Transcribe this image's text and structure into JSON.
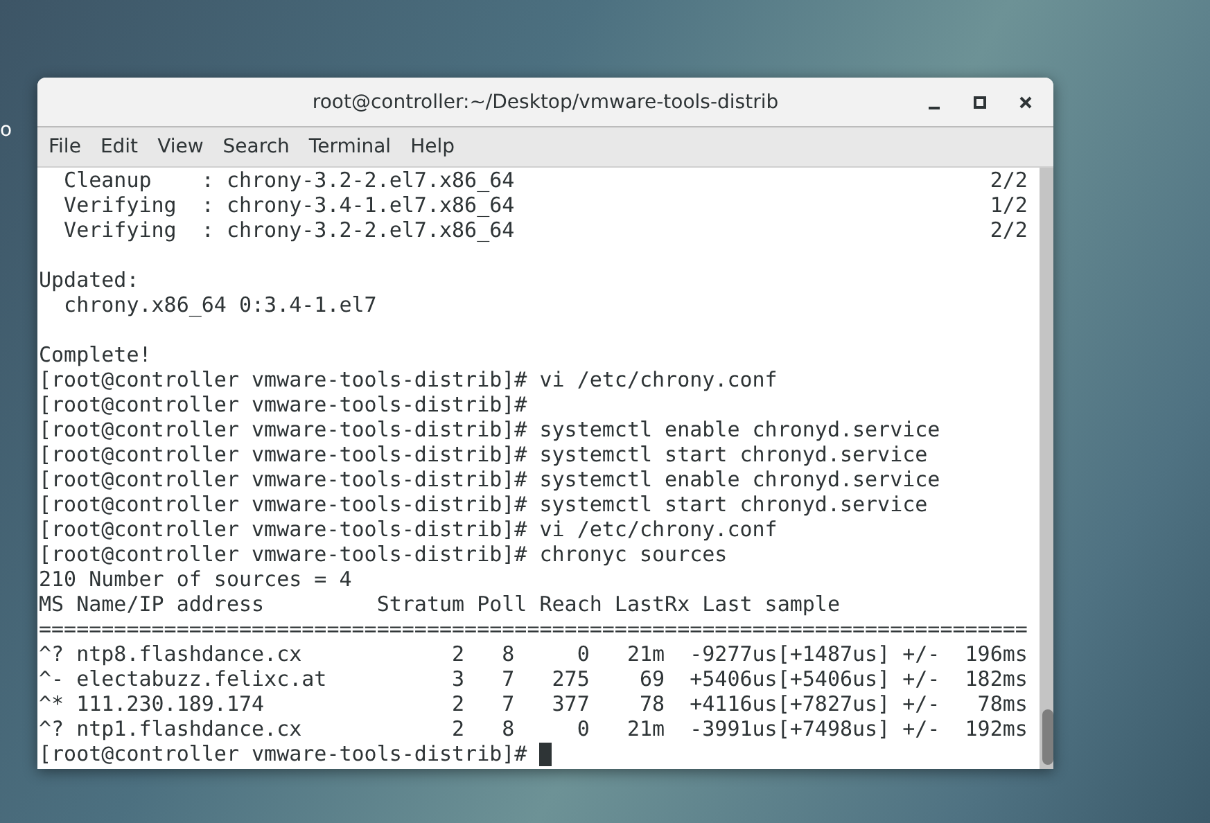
{
  "desktop": {
    "label": "o"
  },
  "window": {
    "title": "root@controller:~/Desktop/vmware-tools-distrib"
  },
  "menu": [
    "File",
    "Edit",
    "View",
    "Search",
    "Terminal",
    "Help"
  ],
  "terminal": {
    "lines": [
      {
        "kind": "text",
        "text": "  Cleanup    : chrony-3.2-2.el7.x86_64",
        "right": "2/2"
      },
      {
        "kind": "text",
        "text": "  Verifying  : chrony-3.4-1.el7.x86_64",
        "right": "1/2"
      },
      {
        "kind": "text",
        "text": "  Verifying  : chrony-3.2-2.el7.x86_64",
        "right": "2/2"
      },
      {
        "kind": "blank"
      },
      {
        "kind": "text",
        "text": "Updated:"
      },
      {
        "kind": "text",
        "text": "  chrony.x86_64 0:3.4-1.el7"
      },
      {
        "kind": "blank"
      },
      {
        "kind": "text",
        "text": "Complete!"
      },
      {
        "kind": "text",
        "text": "[root@controller vmware-tools-distrib]# vi /etc/chrony.conf"
      },
      {
        "kind": "text",
        "text": "[root@controller vmware-tools-distrib]#"
      },
      {
        "kind": "text",
        "text": "[root@controller vmware-tools-distrib]# systemctl enable chronyd.service"
      },
      {
        "kind": "text",
        "text": "[root@controller vmware-tools-distrib]# systemctl start chronyd.service"
      },
      {
        "kind": "text",
        "text": "[root@controller vmware-tools-distrib]# systemctl enable chronyd.service"
      },
      {
        "kind": "text",
        "text": "[root@controller vmware-tools-distrib]# systemctl start chronyd.service"
      },
      {
        "kind": "text",
        "text": "[root@controller vmware-tools-distrib]# vi /etc/chrony.conf"
      },
      {
        "kind": "text",
        "text": "[root@controller vmware-tools-distrib]# chronyc sources"
      },
      {
        "kind": "text",
        "text": "210 Number of sources = 4"
      },
      {
        "kind": "text",
        "text": "MS Name/IP address         Stratum Poll Reach LastRx Last sample"
      },
      {
        "kind": "text",
        "text": "==============================================================================="
      },
      {
        "kind": "text",
        "text": "^? ntp8.flashdance.cx            2   8     0   21m  -9277us[+1487us] +/-  196ms"
      },
      {
        "kind": "text",
        "text": "^- electabuzz.felixc.at          3   7   275    69  +5406us[+5406us] +/-  182ms"
      },
      {
        "kind": "text",
        "text": "^* 111.230.189.174               2   7   377    78  +4116us[+7827us] +/-   78ms"
      },
      {
        "kind": "text",
        "text": "^? ntp1.flashdance.cx            2   8     0   21m  -3991us[+7498us] +/-  192ms"
      },
      {
        "kind": "prompt",
        "text": "[root@controller vmware-tools-distrib]#"
      }
    ]
  }
}
